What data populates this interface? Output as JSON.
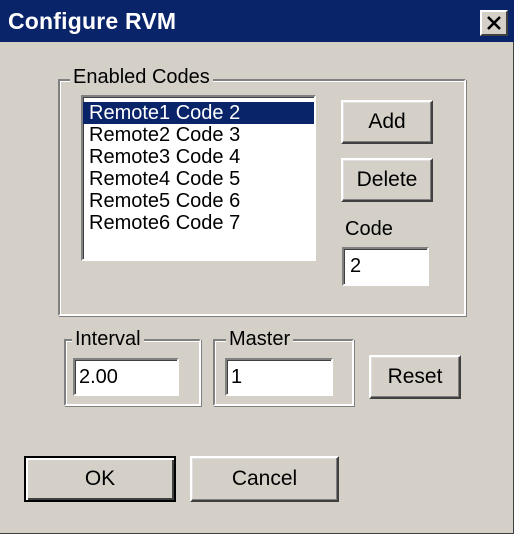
{
  "window": {
    "title": "Configure RVM",
    "close_glyph": "✕"
  },
  "enabled_codes": {
    "legend": "Enabled Codes",
    "items": [
      "Remote1 Code 2",
      "Remote2 Code 3",
      "Remote3 Code 4",
      "Remote4 Code 5",
      "Remote5 Code 6",
      "Remote6 Code 7"
    ],
    "selected_index": 0,
    "add_label": "Add",
    "delete_label": "Delete",
    "code_label": "Code",
    "code_value": "2"
  },
  "interval": {
    "legend": "Interval",
    "value": "2.00"
  },
  "master": {
    "legend": "Master",
    "value": "1"
  },
  "buttons": {
    "reset_label": "Reset",
    "ok_label": "OK",
    "cancel_label": "Cancel"
  },
  "colors": {
    "titlebar": "#0a246a",
    "face": "#d4d0c8",
    "selection": "#0a246a"
  },
  "icons": {
    "close": "close-icon"
  }
}
